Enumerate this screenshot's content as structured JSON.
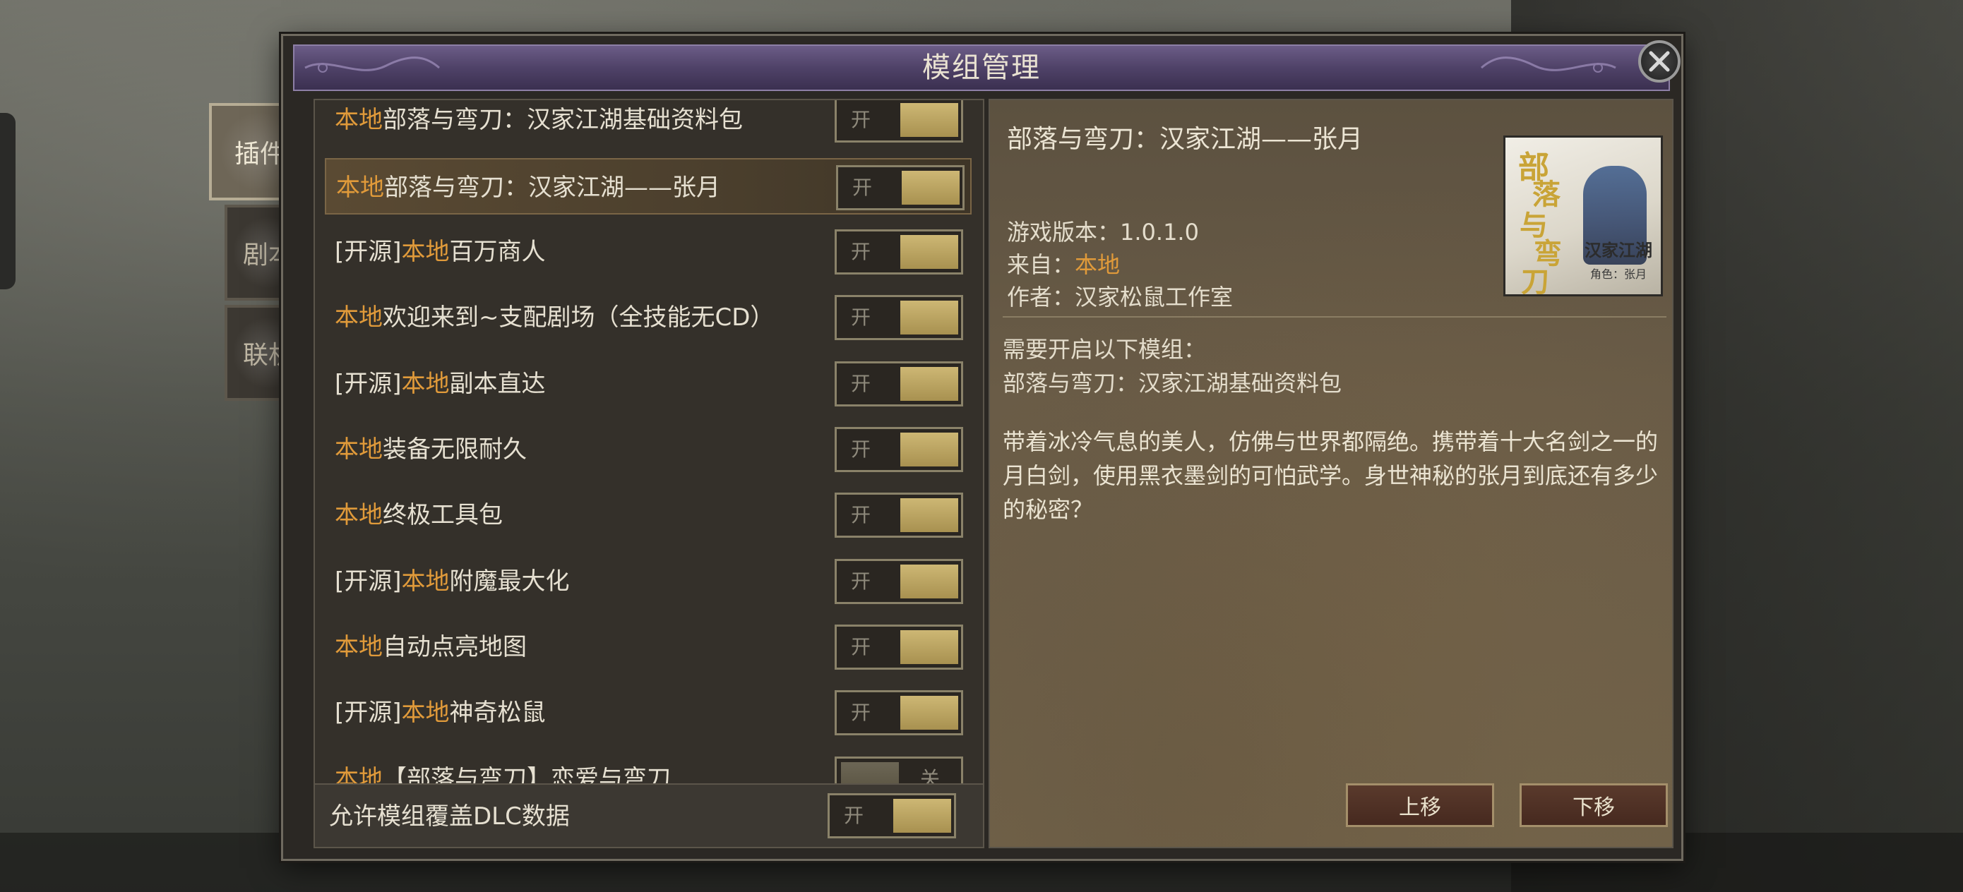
{
  "dialog": {
    "title": "模组管理"
  },
  "tabs": [
    {
      "label": "插件",
      "active": true
    },
    {
      "label": "剧本",
      "active": false
    },
    {
      "label": "联机",
      "active": false
    }
  ],
  "mods": [
    {
      "prefix": "",
      "highlight": "本地",
      "name": "部落与弯刀：汉家江湖基础资料包",
      "toggle": "开",
      "selected": false
    },
    {
      "prefix": "",
      "highlight": "本地",
      "name": "部落与弯刀：汉家江湖——张月",
      "toggle": "开",
      "selected": true
    },
    {
      "prefix": "[开源]",
      "highlight": "本地",
      "name": "百万商人",
      "toggle": "开",
      "selected": false
    },
    {
      "prefix": "",
      "highlight": "本地",
      "name": "欢迎来到~支配剧场（全技能无CD）",
      "toggle": "开",
      "selected": false
    },
    {
      "prefix": "[开源]",
      "highlight": "本地",
      "name": "副本直达",
      "toggle": "开",
      "selected": false
    },
    {
      "prefix": "",
      "highlight": "本地",
      "name": "装备无限耐久",
      "toggle": "开",
      "selected": false
    },
    {
      "prefix": "",
      "highlight": "本地",
      "name": "终极工具包",
      "toggle": "开",
      "selected": false
    },
    {
      "prefix": "[开源]",
      "highlight": "本地",
      "name": "附魔最大化",
      "toggle": "开",
      "selected": false
    },
    {
      "prefix": "",
      "highlight": "本地",
      "name": "自动点亮地图",
      "toggle": "开",
      "selected": false
    },
    {
      "prefix": "[开源]",
      "highlight": "本地",
      "name": "神奇松鼠",
      "toggle": "开",
      "selected": false
    },
    {
      "prefix": "",
      "highlight": "本地",
      "name": "【部落与弯刀】恋爱与弯刀",
      "toggle": "关",
      "selected": false
    }
  ],
  "footer": {
    "label": "允许模组覆盖DLC数据",
    "toggle": "开"
  },
  "detail": {
    "title": "部落与弯刀：汉家江湖——张月",
    "version": "游戏版本：1.0.1.0",
    "source_label": "来自：",
    "source_value": "本地",
    "author": "作者：汉家松鼠工作室",
    "requires_label": "需要开启以下模组：",
    "requires_item": "部落与弯刀：汉家江湖基础资料包",
    "description": "带着冰冷气息的美人，仿佛与世界都隔绝。携带着十大名剑之一的月白剑，使用黑衣墨剑的可怕武学。身世神秘的张月到底还有多少的秘密？",
    "cover": {
      "title_chars": [
        "部",
        "落",
        "与",
        "弯",
        "刀"
      ],
      "subtitle": "汉家江湖",
      "caption": "角色：张月"
    },
    "move_up": "上移",
    "move_down": "下移"
  },
  "colors": {
    "highlight": "#e09a3a",
    "title_bar": "#4f4268",
    "toggle_on": "#b9a25e",
    "panel_bg": "#34302a"
  }
}
